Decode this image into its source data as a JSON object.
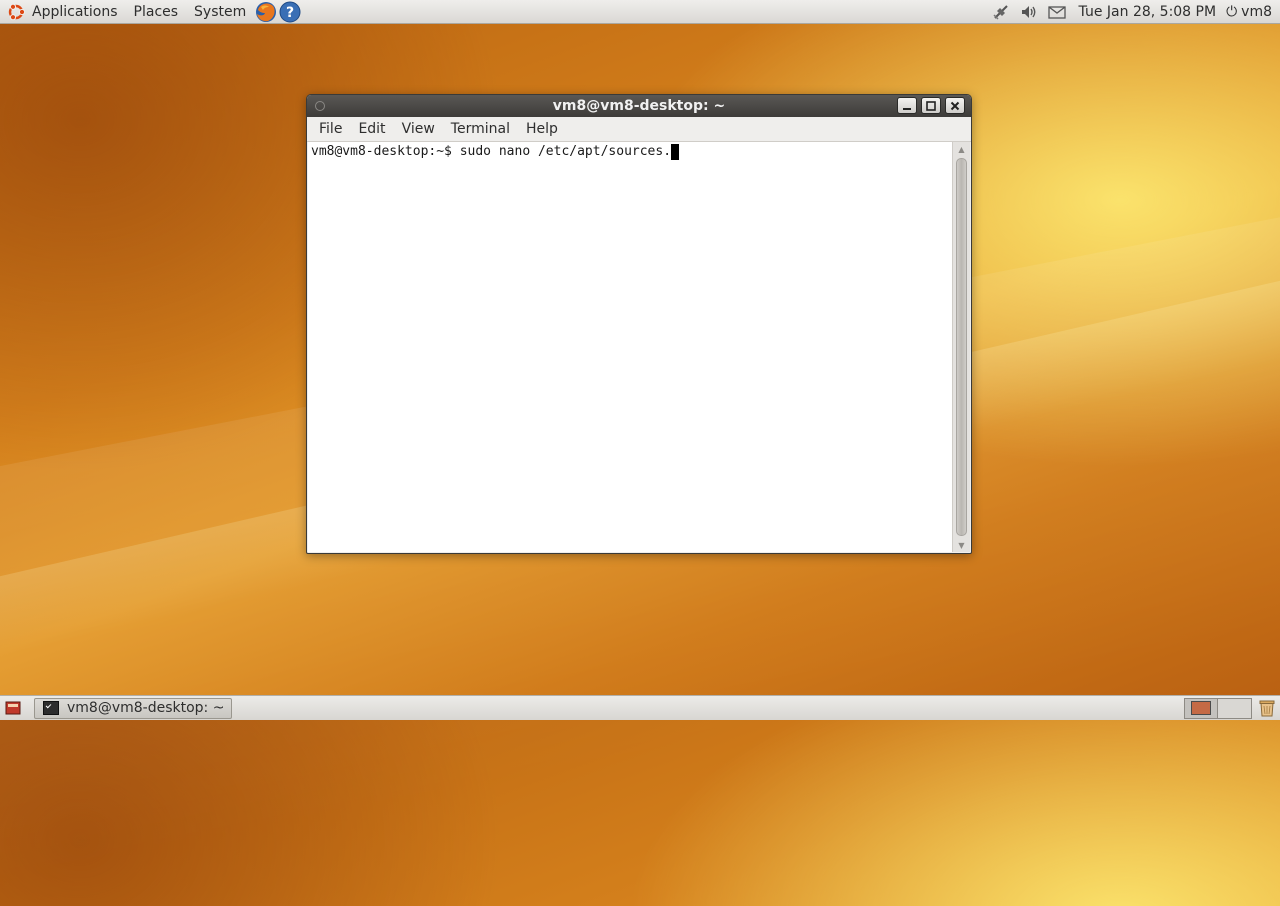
{
  "top_panel": {
    "menus": [
      "Applications",
      "Places",
      "System"
    ],
    "launchers": [
      "firefox-icon",
      "help-icon"
    ],
    "tray_icons": [
      "network-disconnected-icon",
      "volume-icon",
      "mail-icon"
    ],
    "clock": "Tue Jan 28,  5:08 PM",
    "user": "vm8"
  },
  "window": {
    "title": "vm8@vm8-desktop: ~",
    "menu": [
      "File",
      "Edit",
      "View",
      "Terminal",
      "Help"
    ],
    "prompt": "vm8@vm8-desktop:~$ sudo nano /etc/apt/sources."
  },
  "bottom_panel": {
    "task_label": "vm8@vm8-desktop: ~"
  },
  "colors": {
    "desktop_orange": "#d4801c",
    "titlebar": "#3d3b39",
    "panel": "#dad8d4"
  }
}
